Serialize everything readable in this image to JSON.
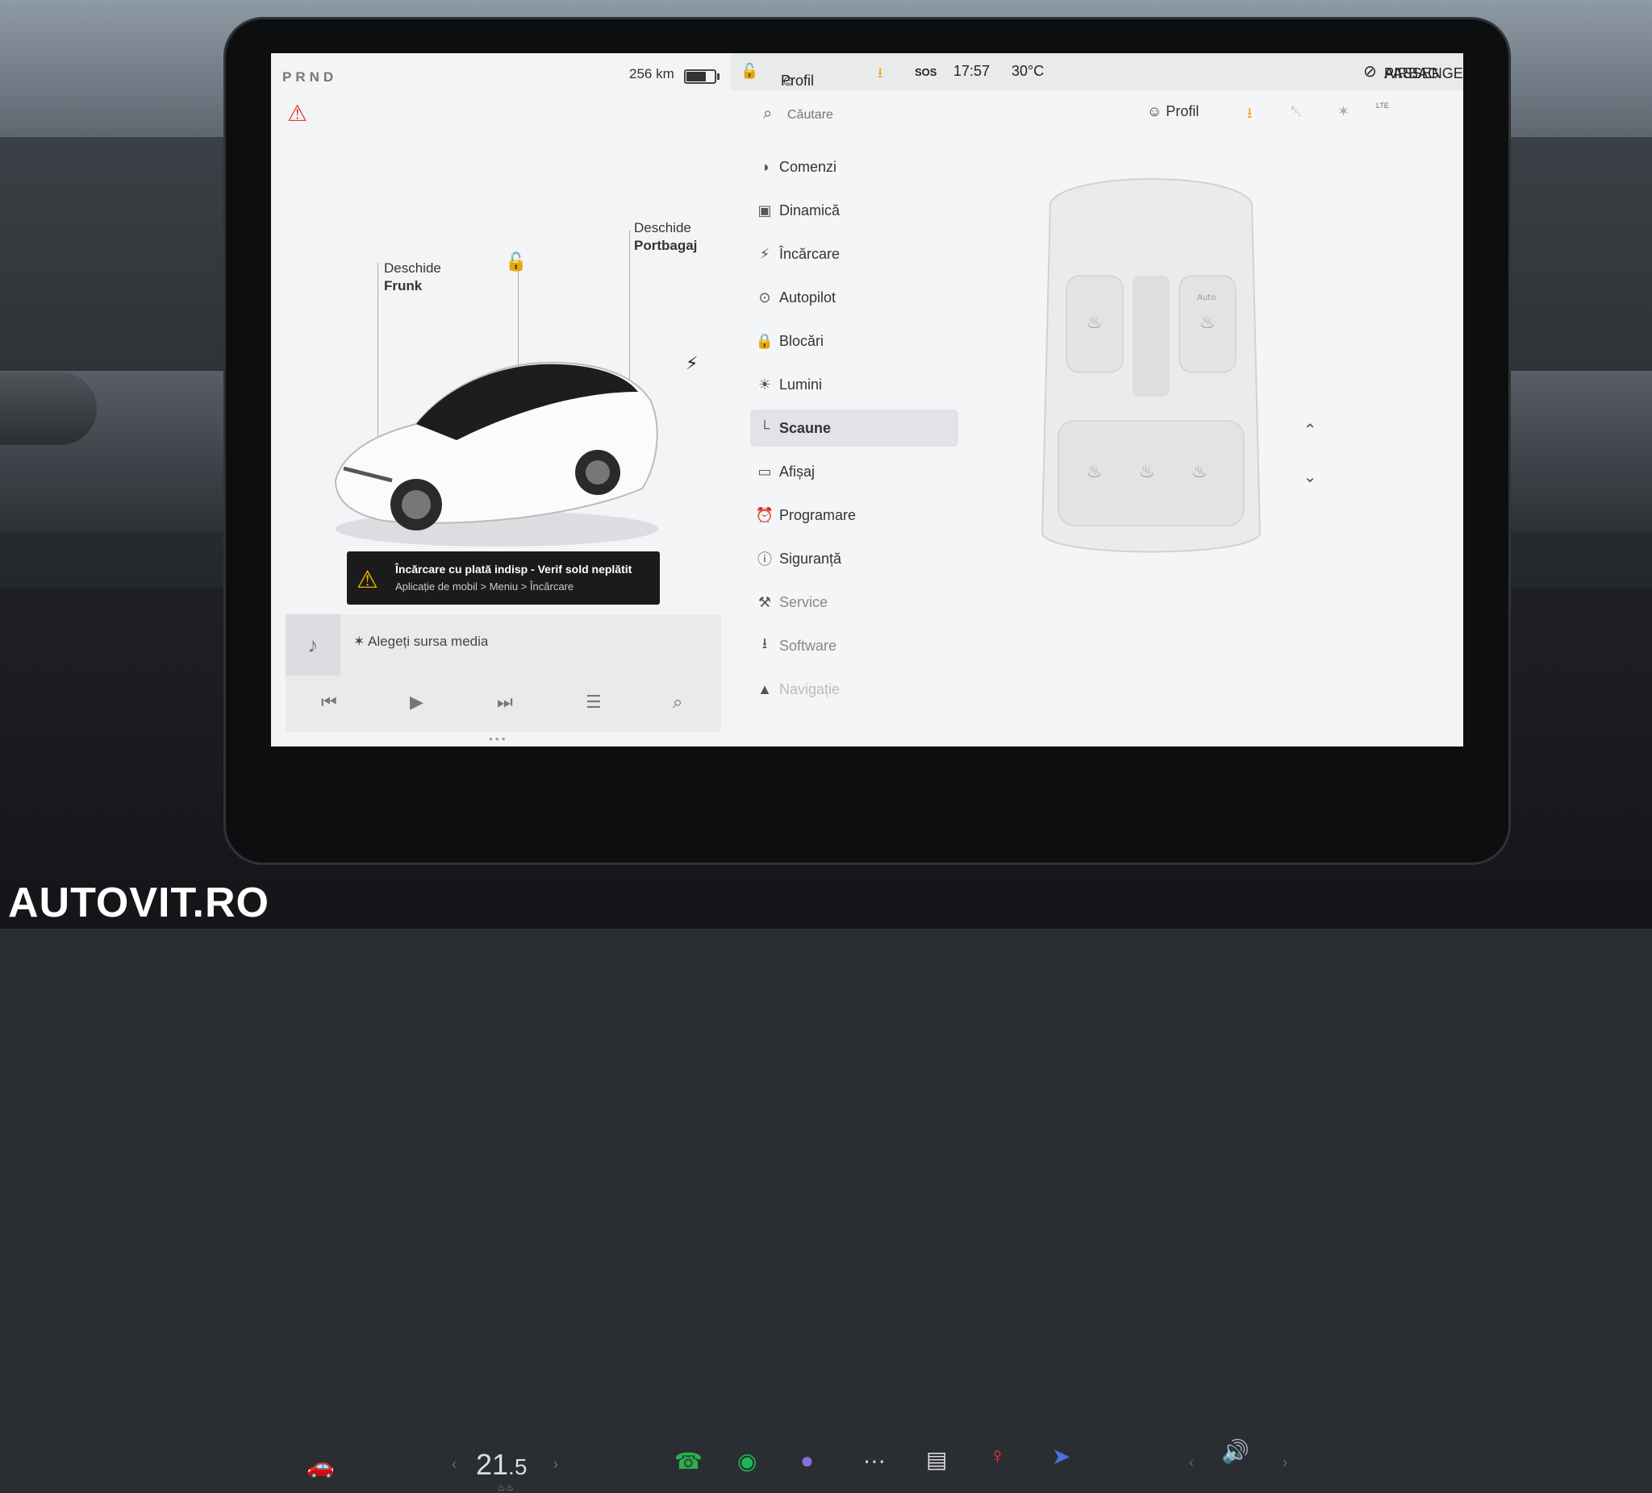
{
  "gear": "PRND",
  "range": "256 km",
  "battery_level": 0.72,
  "status": {
    "profile": "Profil",
    "sos": "SOS",
    "time": "17:57",
    "temperature": "30°C",
    "airbag_line1": "PASSENGER",
    "airbag_line2": "AIRBAG"
  },
  "car_labels": {
    "frunk_line1": "Deschide",
    "frunk_line2": "Frunk",
    "trunk_line1": "Deschide",
    "trunk_line2": "Portbagaj"
  },
  "alert": {
    "title": "Încărcare cu plată indisp - Verif sold neplătit",
    "subtitle": "Aplicație de mobil > Meniu > Încărcare"
  },
  "media": {
    "source": "Alegeți sursa media"
  },
  "search": {
    "placeholder": "Căutare"
  },
  "header": {
    "profile": "Profil",
    "lte": "LTE"
  },
  "menu": [
    {
      "label": "Comenzi"
    },
    {
      "label": "Dinamică"
    },
    {
      "label": "Încărcare"
    },
    {
      "label": "Autopilot"
    },
    {
      "label": "Blocări"
    },
    {
      "label": "Lumini"
    },
    {
      "label": "Scaune"
    },
    {
      "label": "Afișaj"
    },
    {
      "label": "Programare"
    },
    {
      "label": "Siguranță"
    },
    {
      "label": "Service"
    },
    {
      "label": "Software"
    },
    {
      "label": "Navigație"
    }
  ],
  "seats": {
    "auto_label": "Auto"
  },
  "climate": {
    "temp_main": "21",
    "temp_decimal": ".5"
  },
  "watermark": "AUTOVIT.RO",
  "colors": {
    "accent_orange": "#f5a623",
    "seatbelt_red": "#e53935",
    "phone_green": "#2bb24c",
    "spotify_green": "#1db954"
  }
}
